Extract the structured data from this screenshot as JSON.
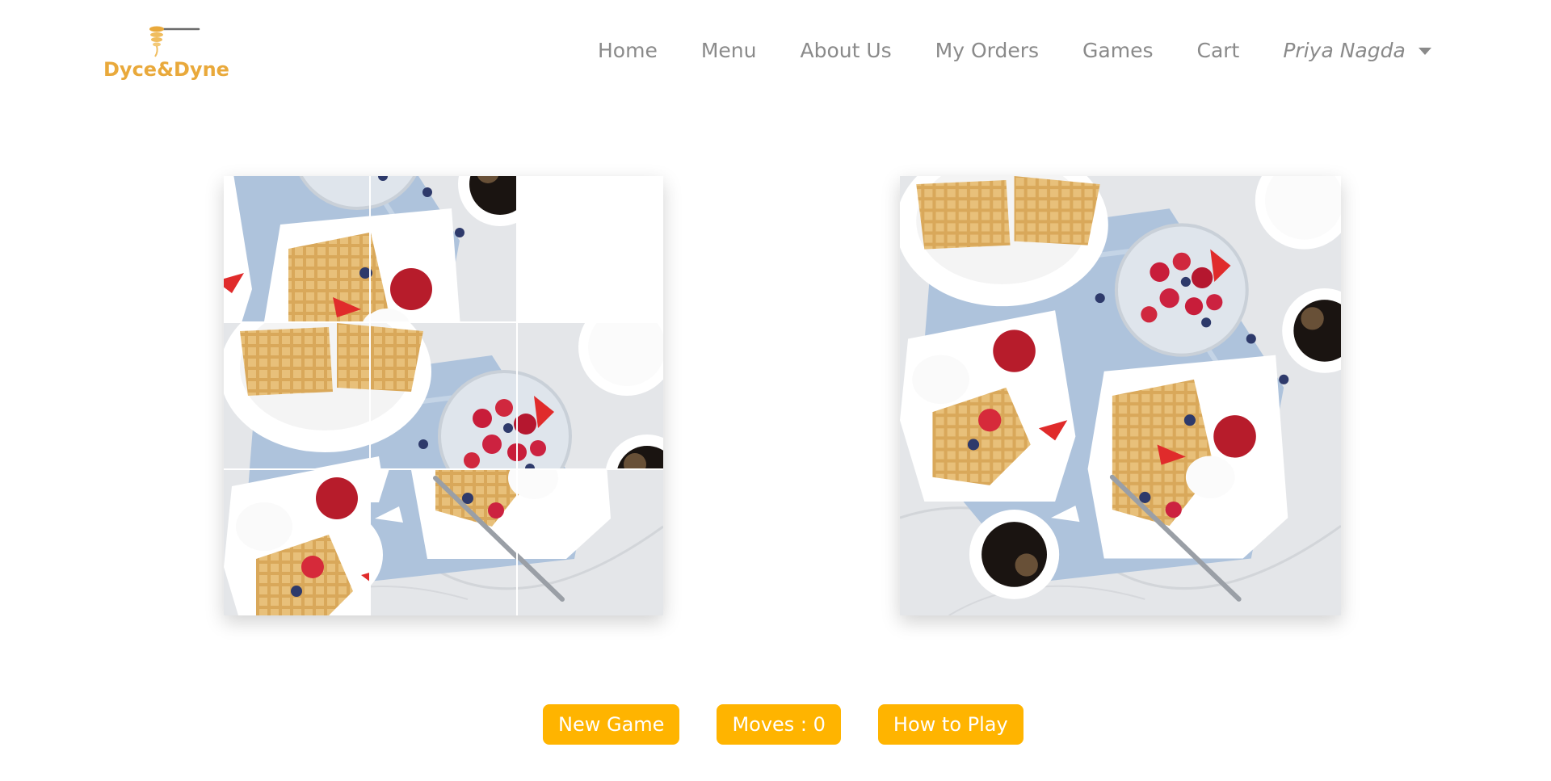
{
  "brand": {
    "name": "Dyce&Dyne",
    "logo_icon": "whisk-honey-dipper-icon",
    "color": "#e9a93b"
  },
  "nav": {
    "items": [
      {
        "label": "Home"
      },
      {
        "label": "Menu"
      },
      {
        "label": "About Us"
      },
      {
        "label": "My Orders"
      },
      {
        "label": "Games"
      },
      {
        "label": "Cart"
      }
    ],
    "user": {
      "label": "Priya Nagda",
      "icon": "caret-down-icon"
    }
  },
  "puzzle": {
    "grid_size": 3,
    "tiles": [
      {
        "piece": 4
      },
      {
        "piece": 5
      },
      {
        "piece": null
      },
      {
        "piece": 0
      },
      {
        "piece": 1
      },
      {
        "piece": 2
      },
      {
        "piece": 3
      },
      {
        "piece": 7
      },
      {
        "piece": 8
      }
    ]
  },
  "preview": {
    "alt": "waffles-breakfast-preview-image"
  },
  "controls": {
    "new_game_label": "New Game",
    "moves_label": "Moves : 0",
    "how_to_play_label": "How to Play"
  },
  "colors": {
    "accent": "#ffb400",
    "nav_text": "#8a8a8a",
    "button_text": "#ffffff"
  }
}
